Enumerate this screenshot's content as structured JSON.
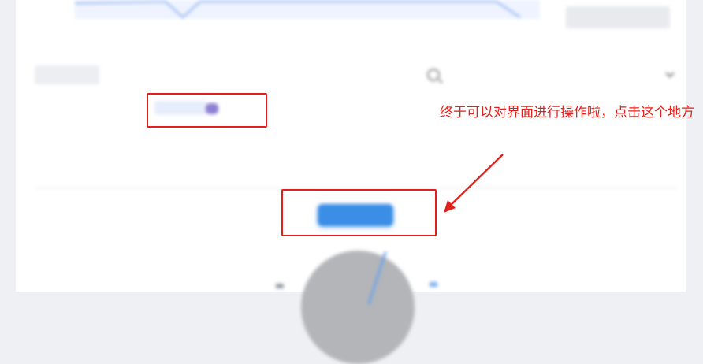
{
  "top_chart": {
    "ticks": [
      "",
      "",
      "",
      "",
      "",
      "",
      "",
      "",
      "",
      ""
    ]
  },
  "top_right_button": {
    "label": ""
  },
  "toolbar": {
    "chip_label": "",
    "search_placeholder": "",
    "separator": "",
    "select_value": ""
  },
  "token_row": {
    "label": "",
    "token_value": ""
  },
  "description": {
    "text": "",
    "link": ""
  },
  "table": {
    "col_left": "",
    "col_right": ""
  },
  "primary_button": {
    "label": ""
  },
  "annotation": {
    "text": "终于可以对界面进行操作啦，点击这个地方",
    "color": "#e0201b"
  },
  "colors": {
    "accent": "#3a8ee6",
    "annotation_red": "#e0201b",
    "background": "#eef0f3"
  }
}
